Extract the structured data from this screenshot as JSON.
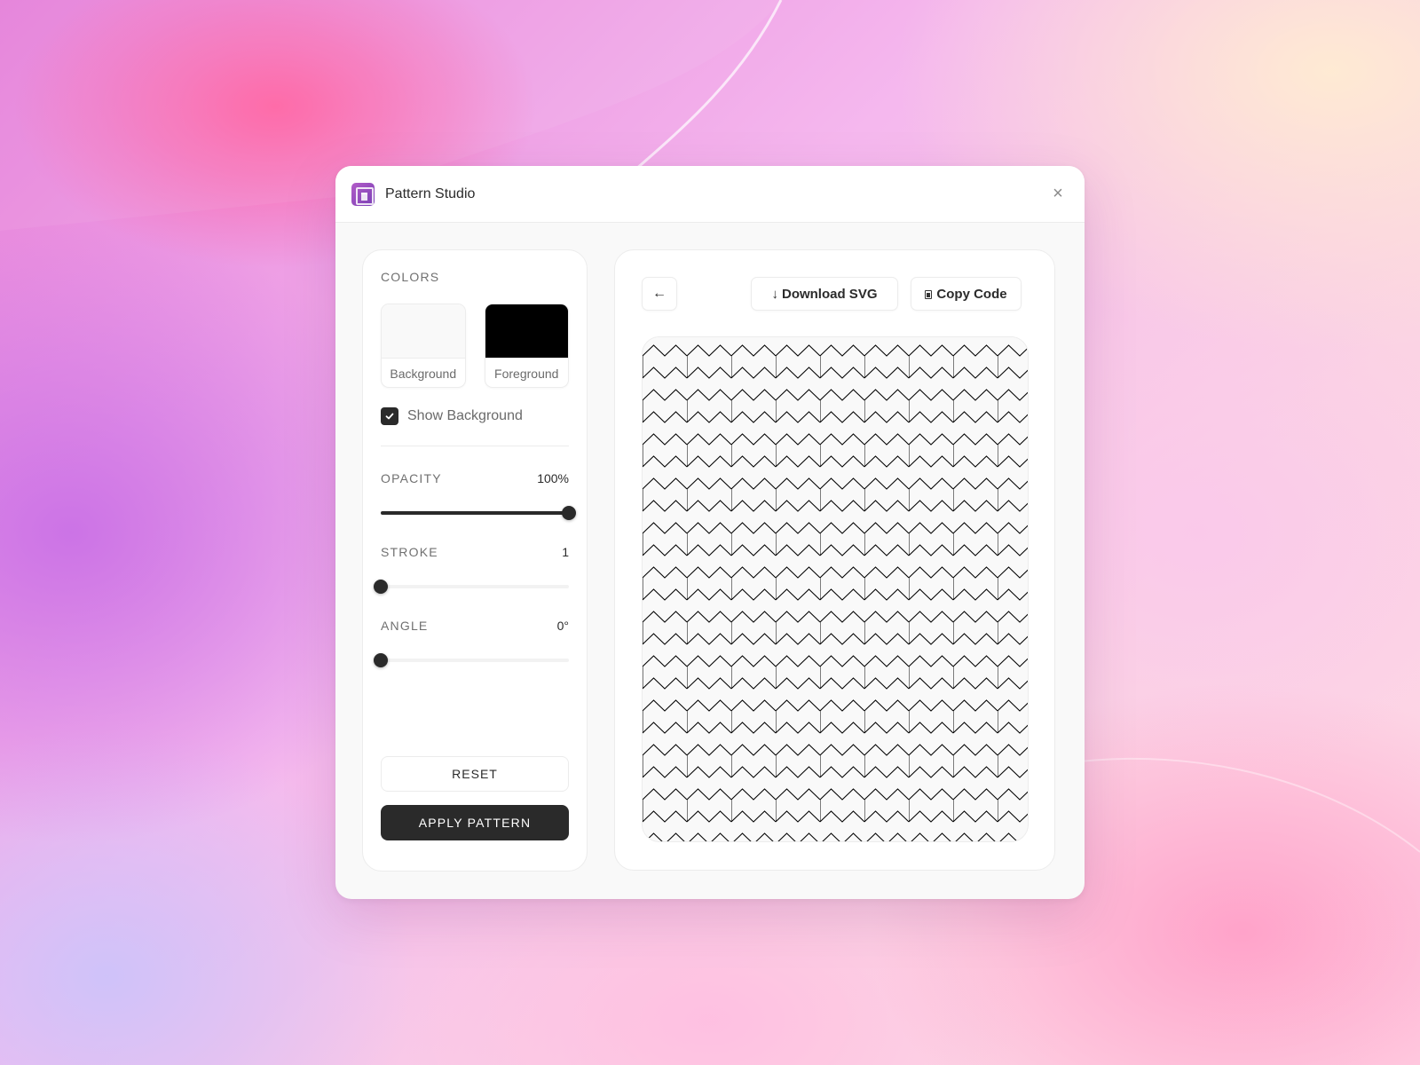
{
  "window": {
    "title": "Pattern Studio",
    "logo_icon": "pattern-studio-logo",
    "close_icon": "close-icon",
    "close_glyph": "×"
  },
  "controls": {
    "colors_label": "COLORS",
    "swatches": [
      {
        "label": "Background",
        "color": "#f9f9f9"
      },
      {
        "label": "Foreground",
        "color": "#000000"
      }
    ],
    "show_background": {
      "label": "Show Background",
      "checked": true
    },
    "sliders": [
      {
        "label": "OPACITY",
        "value_text": "100%",
        "value": 100,
        "min": 0,
        "max": 100
      },
      {
        "label": "STROKE",
        "value_text": "1",
        "value": 1,
        "min": 1,
        "max": 10
      },
      {
        "label": "ANGLE",
        "value_text": "0°",
        "value": 0,
        "min": 0,
        "max": 360
      }
    ],
    "reset_label": "RESET",
    "apply_label": "APPLY PATTERN"
  },
  "preview": {
    "back_icon": "arrow-left-icon",
    "back_glyph": "←",
    "download_icon_glyph": "↓",
    "download_label": "Download SVG",
    "copy_label": "Copy Code",
    "pattern": {
      "name": "zigzag-tiles",
      "background": "#f9f9f9",
      "foreground": "#000000",
      "stroke_width": 1,
      "opacity": 1,
      "angle": 0
    }
  },
  "colors": {
    "accent_dark": "#2a2a2a",
    "logo_gradient_start": "#b25cc8",
    "logo_gradient_end": "#7a3fb5"
  }
}
